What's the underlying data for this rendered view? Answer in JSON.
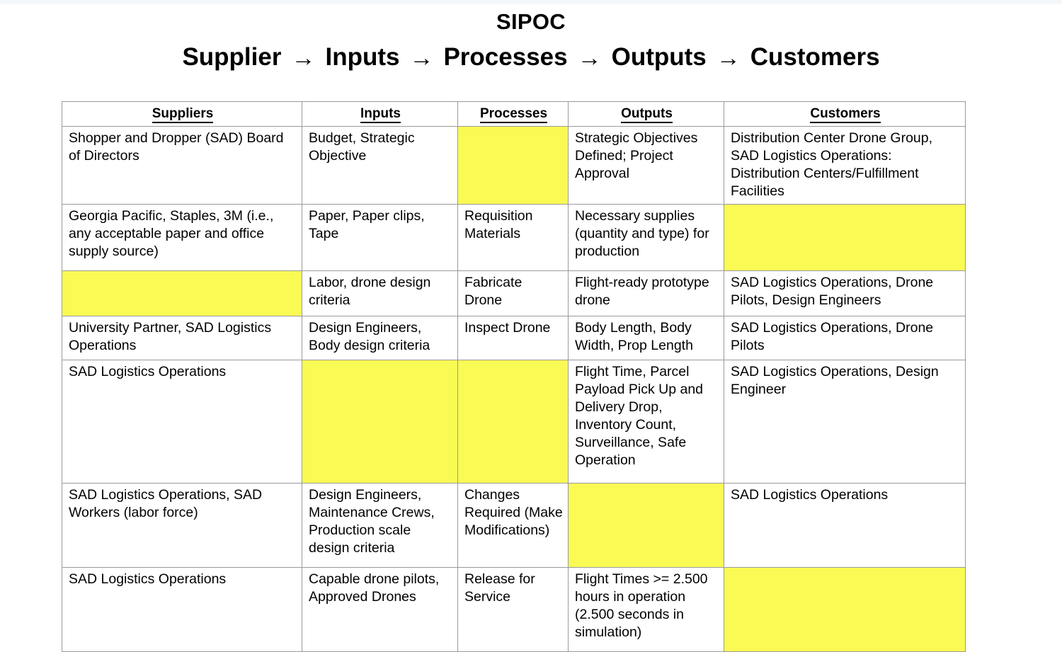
{
  "title": {
    "main": "SIPOC",
    "flow_parts": [
      "Supplier",
      "Inputs",
      "Processes",
      "Outputs",
      "Customers"
    ],
    "arrow_glyph": "→"
  },
  "table": {
    "headers": [
      "Suppliers",
      "Inputs",
      "Processes",
      "Outputs",
      "Customers"
    ],
    "highlight_color": "#fafa55",
    "rows": [
      {
        "suppliers": "Shopper and Dropper (SAD) Board of Directors",
        "inputs": "Budget, Strategic Objective",
        "processes": "",
        "outputs": "Strategic Objectives Defined; Project Approval",
        "customers": "Distribution Center Drone Group, SAD Logistics Operations: Distribution Centers/Fulfillment Facilities",
        "highlight": [
          "processes"
        ]
      },
      {
        "suppliers": "Georgia Pacific, Staples, 3M (i.e., any acceptable paper and office supply source)",
        "inputs": "Paper, Paper clips, Tape",
        "processes": "Requisition Materials",
        "outputs": "Necessary supplies (quantity and type) for production",
        "customers": "",
        "highlight": [
          "customers"
        ]
      },
      {
        "suppliers": "",
        "inputs": "Labor, drone design criteria",
        "processes": "Fabricate Drone",
        "outputs": "Flight-ready prototype drone",
        "customers": "SAD Logistics Operations, Drone Pilots, Design Engineers",
        "highlight": [
          "suppliers"
        ]
      },
      {
        "suppliers": "University Partner, SAD Logistics Operations",
        "inputs": "Design Engineers, Body design criteria",
        "processes": "Inspect Drone",
        "outputs": "Body Length, Body Width, Prop Length",
        "customers": "SAD Logistics Operations, Drone Pilots",
        "highlight": []
      },
      {
        "suppliers": "SAD Logistics Operations",
        "inputs": "",
        "processes": "",
        "outputs": "Flight Time, Parcel Payload Pick Up and Delivery Drop, Inventory Count, Surveillance, Safe Operation",
        "customers": "SAD Logistics Operations, Design Engineer",
        "highlight": [
          "inputs",
          "processes"
        ]
      },
      {
        "suppliers": "SAD Logistics Operations, SAD Workers (labor force)",
        "inputs": "Design Engineers, Maintenance Crews, Production scale design criteria",
        "processes": "Changes Required (Make Modifications)",
        "outputs": "",
        "customers": "SAD Logistics Operations",
        "highlight": [
          "outputs"
        ]
      },
      {
        "suppliers": "SAD Logistics Operations",
        "inputs": "Capable drone pilots, Approved Drones",
        "processes": "Release for Service",
        "outputs": "Flight Times >= 2.500 hours in operation (2.500 seconds in simulation)",
        "customers": "",
        "highlight": [
          "customers"
        ]
      }
    ]
  }
}
